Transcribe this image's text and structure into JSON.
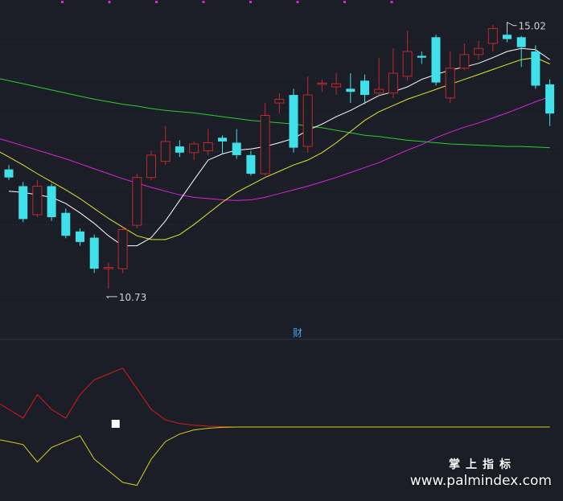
{
  "colors": {
    "background": "#1b1e27",
    "grid": "#2e3240",
    "up": "#c02a2a",
    "down": "#3fe0ea",
    "ma5": "#ffffff",
    "ma10": "#e5e52c",
    "ma20": "#d726d7",
    "ma60": "#2ccd2c",
    "osc_red": "#d51c1c",
    "osc_yellow": "#d7cf1c",
    "label": "#d0d0d0",
    "marker": "#d726d7",
    "panel_tab": "#4aa3f0"
  },
  "chart_data": [
    {
      "type": "candlestick",
      "ylim": [
        10.3,
        15.25
      ],
      "candles": [
        {
          "o": 12.65,
          "c": 12.52,
          "h": 12.72,
          "l": 12.48
        },
        {
          "o": 12.38,
          "c": 11.85,
          "h": 12.45,
          "l": 11.8
        },
        {
          "o": 11.92,
          "c": 12.38,
          "h": 12.48,
          "l": 11.88
        },
        {
          "o": 12.38,
          "c": 11.88,
          "h": 12.42,
          "l": 11.82
        },
        {
          "o": 11.95,
          "c": 11.58,
          "h": 12.02,
          "l": 11.54
        },
        {
          "o": 11.65,
          "c": 11.48,
          "h": 11.7,
          "l": 11.42
        },
        {
          "o": 11.55,
          "c": 11.05,
          "h": 11.6,
          "l": 10.98
        },
        {
          "o": 11.05,
          "c": 11.07,
          "h": 11.15,
          "l": 10.73
        },
        {
          "o": 11.05,
          "c": 11.68,
          "h": 11.72,
          "l": 10.98
        },
        {
          "o": 11.75,
          "c": 12.52,
          "h": 12.58,
          "l": 11.7
        },
        {
          "o": 12.52,
          "c": 12.88,
          "h": 12.95,
          "l": 12.48
        },
        {
          "o": 12.78,
          "c": 13.1,
          "h": 13.35,
          "l": 12.72
        },
        {
          "o": 13.02,
          "c": 12.92,
          "h": 13.12,
          "l": 12.85
        },
        {
          "o": 12.92,
          "c": 13.06,
          "h": 13.1,
          "l": 12.8
        },
        {
          "o": 12.95,
          "c": 13.08,
          "h": 13.3,
          "l": 12.88
        },
        {
          "o": 13.16,
          "c": 13.1,
          "h": 13.2,
          "l": 12.9
        },
        {
          "o": 13.08,
          "c": 12.88,
          "h": 13.3,
          "l": 12.82
        },
        {
          "o": 12.88,
          "c": 12.58,
          "h": 12.95,
          "l": 12.55
        },
        {
          "o": 12.58,
          "c": 13.52,
          "h": 13.72,
          "l": 12.55
        },
        {
          "o": 13.72,
          "c": 13.78,
          "h": 13.88,
          "l": 13.55
        },
        {
          "o": 13.85,
          "c": 13.0,
          "h": 13.95,
          "l": 12.92
        },
        {
          "o": 13.02,
          "c": 13.85,
          "h": 14.15,
          "l": 12.92
        },
        {
          "o": 14.02,
          "c": 14.04,
          "h": 14.1,
          "l": 13.9
        },
        {
          "o": 13.98,
          "c": 14.03,
          "h": 14.2,
          "l": 13.85
        },
        {
          "o": 13.95,
          "c": 13.9,
          "h": 14.2,
          "l": 13.72
        },
        {
          "o": 14.08,
          "c": 13.85,
          "h": 14.18,
          "l": 13.7
        },
        {
          "o": 13.88,
          "c": 13.94,
          "h": 14.45,
          "l": 13.84
        },
        {
          "o": 13.88,
          "c": 14.2,
          "h": 14.6,
          "l": 13.8
        },
        {
          "o": 14.15,
          "c": 14.55,
          "h": 14.88,
          "l": 14.08
        },
        {
          "o": 14.48,
          "c": 14.45,
          "h": 14.55,
          "l": 14.35
        },
        {
          "o": 14.78,
          "c": 14.05,
          "h": 14.82,
          "l": 14.0
        },
        {
          "o": 13.8,
          "c": 14.28,
          "h": 14.55,
          "l": 13.72
        },
        {
          "o": 14.28,
          "c": 14.5,
          "h": 14.68,
          "l": 14.25
        },
        {
          "o": 14.5,
          "c": 14.6,
          "h": 14.72,
          "l": 14.42
        },
        {
          "o": 14.68,
          "c": 14.92,
          "h": 14.98,
          "l": 14.55
        },
        {
          "o": 14.82,
          "c": 14.75,
          "h": 15.02,
          "l": 14.7
        },
        {
          "o": 14.78,
          "c": 14.62,
          "h": 14.8,
          "l": 14.3
        },
        {
          "o": 14.55,
          "c": 14.0,
          "h": 14.65,
          "l": 13.95
        },
        {
          "o": 14.02,
          "c": 13.55,
          "h": 14.1,
          "l": 13.35
        }
      ],
      "ma5": [
        12.3,
        12.28,
        12.24,
        12.2,
        12.1,
        11.95,
        11.78,
        11.58,
        11.42,
        11.42,
        11.55,
        11.82,
        12.15,
        12.48,
        12.8,
        12.9,
        12.96,
        12.98,
        13.02,
        13.08,
        13.15,
        13.28,
        13.38,
        13.5,
        13.6,
        13.72,
        13.84,
        13.9,
        13.98,
        14.1,
        14.18,
        14.25,
        14.3,
        14.36,
        14.45,
        14.55,
        14.6,
        14.58,
        14.42
      ],
      "ma10": [
        12.85,
        12.72,
        12.58,
        12.45,
        12.32,
        12.18,
        12.02,
        11.86,
        11.72,
        11.58,
        11.52,
        11.52,
        11.6,
        11.76,
        11.94,
        12.12,
        12.28,
        12.4,
        12.52,
        12.62,
        12.72,
        12.8,
        12.92,
        13.08,
        13.26,
        13.44,
        13.58,
        13.68,
        13.78,
        13.86,
        13.94,
        14.02,
        14.1,
        14.18,
        14.26,
        14.34,
        14.42,
        14.45,
        14.35
      ],
      "ma20": [
        13.1,
        13.03,
        12.96,
        12.89,
        12.82,
        12.74,
        12.66,
        12.58,
        12.5,
        12.43,
        12.36,
        12.3,
        12.24,
        12.2,
        12.18,
        12.16,
        12.15,
        12.16,
        12.2,
        12.26,
        12.32,
        12.38,
        12.45,
        12.52,
        12.6,
        12.68,
        12.76,
        12.86,
        12.96,
        13.05,
        13.16,
        13.25,
        13.33,
        13.4,
        13.48,
        13.56,
        13.65,
        13.74,
        13.82
      ],
      "ma60": [
        14.08,
        14.03,
        13.98,
        13.93,
        13.88,
        13.83,
        13.78,
        13.74,
        13.7,
        13.67,
        13.63,
        13.6,
        13.58,
        13.56,
        13.53,
        13.5,
        13.47,
        13.44,
        13.42,
        13.4,
        13.38,
        13.35,
        13.32,
        13.28,
        13.24,
        13.2,
        13.18,
        13.15,
        13.12,
        13.1,
        13.08,
        13.06,
        13.05,
        13.04,
        13.03,
        13.02,
        13.02,
        13.01,
        13.0
      ],
      "annotations": {
        "high": "15.02",
        "low": "10.73",
        "high_index": 35,
        "low_index": 7
      },
      "panel_tab": "财",
      "markers_count": 8
    },
    {
      "type": "line",
      "ylim": [
        -1.2,
        1.2
      ],
      "series_red": [
        0.3,
        0.15,
        0.55,
        0.3,
        0.15,
        0.55,
        0.8,
        0.9,
        1.0,
        0.65,
        0.3,
        0.12,
        0.06,
        0.03,
        0.015,
        0.005,
        0.0,
        0.0,
        0.0,
        0.0,
        0.0,
        0.0,
        0.0,
        0.0,
        0.0,
        0.0,
        0.0,
        0.0,
        0.0,
        0.0,
        0.0,
        0.0,
        0.0,
        0.0,
        0.0,
        0.0,
        0.0,
        0.0,
        0.0
      ],
      "series_yellow": [
        -0.25,
        -0.3,
        -0.6,
        -0.35,
        -0.25,
        -0.15,
        -0.55,
        -0.75,
        -0.95,
        -1.0,
        -0.55,
        -0.25,
        -0.12,
        -0.05,
        -0.02,
        -0.005,
        0.0,
        0.0,
        0.0,
        0.0,
        0.0,
        0.0,
        0.0,
        0.0,
        0.0,
        0.0,
        0.0,
        0.0,
        0.0,
        0.0,
        0.0,
        0.0,
        0.0,
        0.0,
        0.0,
        0.0,
        0.0,
        0.0,
        0.0
      ],
      "square_index": 7.5
    }
  ],
  "watermark": {
    "line1": "掌上指标",
    "line2": "www.palmindex.com"
  }
}
